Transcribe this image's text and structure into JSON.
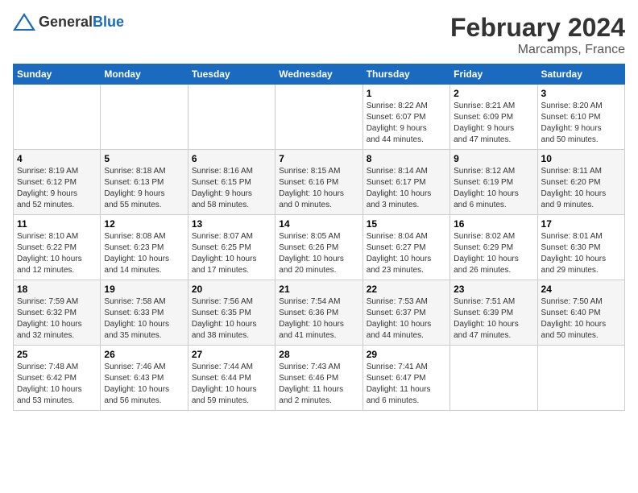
{
  "header": {
    "logo_general": "General",
    "logo_blue": "Blue",
    "month_year": "February 2024",
    "location": "Marcamps, France"
  },
  "days_of_week": [
    "Sunday",
    "Monday",
    "Tuesday",
    "Wednesday",
    "Thursday",
    "Friday",
    "Saturday"
  ],
  "weeks": [
    [
      {
        "day": "",
        "info": ""
      },
      {
        "day": "",
        "info": ""
      },
      {
        "day": "",
        "info": ""
      },
      {
        "day": "",
        "info": ""
      },
      {
        "day": "1",
        "info": "Sunrise: 8:22 AM\nSunset: 6:07 PM\nDaylight: 9 hours\nand 44 minutes."
      },
      {
        "day": "2",
        "info": "Sunrise: 8:21 AM\nSunset: 6:09 PM\nDaylight: 9 hours\nand 47 minutes."
      },
      {
        "day": "3",
        "info": "Sunrise: 8:20 AM\nSunset: 6:10 PM\nDaylight: 9 hours\nand 50 minutes."
      }
    ],
    [
      {
        "day": "4",
        "info": "Sunrise: 8:19 AM\nSunset: 6:12 PM\nDaylight: 9 hours\nand 52 minutes."
      },
      {
        "day": "5",
        "info": "Sunrise: 8:18 AM\nSunset: 6:13 PM\nDaylight: 9 hours\nand 55 minutes."
      },
      {
        "day": "6",
        "info": "Sunrise: 8:16 AM\nSunset: 6:15 PM\nDaylight: 9 hours\nand 58 minutes."
      },
      {
        "day": "7",
        "info": "Sunrise: 8:15 AM\nSunset: 6:16 PM\nDaylight: 10 hours\nand 0 minutes."
      },
      {
        "day": "8",
        "info": "Sunrise: 8:14 AM\nSunset: 6:17 PM\nDaylight: 10 hours\nand 3 minutes."
      },
      {
        "day": "9",
        "info": "Sunrise: 8:12 AM\nSunset: 6:19 PM\nDaylight: 10 hours\nand 6 minutes."
      },
      {
        "day": "10",
        "info": "Sunrise: 8:11 AM\nSunset: 6:20 PM\nDaylight: 10 hours\nand 9 minutes."
      }
    ],
    [
      {
        "day": "11",
        "info": "Sunrise: 8:10 AM\nSunset: 6:22 PM\nDaylight: 10 hours\nand 12 minutes."
      },
      {
        "day": "12",
        "info": "Sunrise: 8:08 AM\nSunset: 6:23 PM\nDaylight: 10 hours\nand 14 minutes."
      },
      {
        "day": "13",
        "info": "Sunrise: 8:07 AM\nSunset: 6:25 PM\nDaylight: 10 hours\nand 17 minutes."
      },
      {
        "day": "14",
        "info": "Sunrise: 8:05 AM\nSunset: 6:26 PM\nDaylight: 10 hours\nand 20 minutes."
      },
      {
        "day": "15",
        "info": "Sunrise: 8:04 AM\nSunset: 6:27 PM\nDaylight: 10 hours\nand 23 minutes."
      },
      {
        "day": "16",
        "info": "Sunrise: 8:02 AM\nSunset: 6:29 PM\nDaylight: 10 hours\nand 26 minutes."
      },
      {
        "day": "17",
        "info": "Sunrise: 8:01 AM\nSunset: 6:30 PM\nDaylight: 10 hours\nand 29 minutes."
      }
    ],
    [
      {
        "day": "18",
        "info": "Sunrise: 7:59 AM\nSunset: 6:32 PM\nDaylight: 10 hours\nand 32 minutes."
      },
      {
        "day": "19",
        "info": "Sunrise: 7:58 AM\nSunset: 6:33 PM\nDaylight: 10 hours\nand 35 minutes."
      },
      {
        "day": "20",
        "info": "Sunrise: 7:56 AM\nSunset: 6:35 PM\nDaylight: 10 hours\nand 38 minutes."
      },
      {
        "day": "21",
        "info": "Sunrise: 7:54 AM\nSunset: 6:36 PM\nDaylight: 10 hours\nand 41 minutes."
      },
      {
        "day": "22",
        "info": "Sunrise: 7:53 AM\nSunset: 6:37 PM\nDaylight: 10 hours\nand 44 minutes."
      },
      {
        "day": "23",
        "info": "Sunrise: 7:51 AM\nSunset: 6:39 PM\nDaylight: 10 hours\nand 47 minutes."
      },
      {
        "day": "24",
        "info": "Sunrise: 7:50 AM\nSunset: 6:40 PM\nDaylight: 10 hours\nand 50 minutes."
      }
    ],
    [
      {
        "day": "25",
        "info": "Sunrise: 7:48 AM\nSunset: 6:42 PM\nDaylight: 10 hours\nand 53 minutes."
      },
      {
        "day": "26",
        "info": "Sunrise: 7:46 AM\nSunset: 6:43 PM\nDaylight: 10 hours\nand 56 minutes."
      },
      {
        "day": "27",
        "info": "Sunrise: 7:44 AM\nSunset: 6:44 PM\nDaylight: 10 hours\nand 59 minutes."
      },
      {
        "day": "28",
        "info": "Sunrise: 7:43 AM\nSunset: 6:46 PM\nDaylight: 11 hours\nand 2 minutes."
      },
      {
        "day": "29",
        "info": "Sunrise: 7:41 AM\nSunset: 6:47 PM\nDaylight: 11 hours\nand 6 minutes."
      },
      {
        "day": "",
        "info": ""
      },
      {
        "day": "",
        "info": ""
      }
    ]
  ]
}
